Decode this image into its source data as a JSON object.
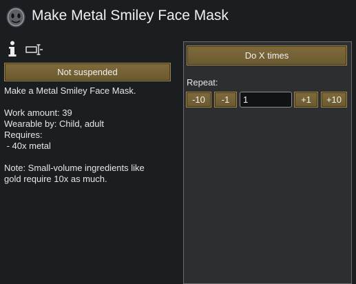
{
  "window": {
    "title": "Make Metal Smiley Face Mask"
  },
  "icons": {
    "recipe": "mask-icon",
    "info": "info-icon",
    "rename": "rename-icon"
  },
  "left": {
    "suspend_label": "Not suspended",
    "description": [
      "Make a Metal Smiley Face Mask.",
      "",
      "Work amount: 39",
      "Wearable by: Child, adult",
      "Requires:",
      " - 40x metal",
      "",
      "Note: Small-volume ingredients like",
      "gold require 10x as much."
    ]
  },
  "right": {
    "mode_label": "Do X times",
    "repeat_label": "Repeat:",
    "buttons": {
      "minus10": "-10",
      "minus1": "-1",
      "plus1": "+1",
      "plus10": "+10"
    },
    "repeat_value": "1"
  },
  "colors": {
    "background": "#1b1e21",
    "panel": "#2c2e30",
    "button": "#7f6a3a",
    "button_border": "#a08748"
  }
}
